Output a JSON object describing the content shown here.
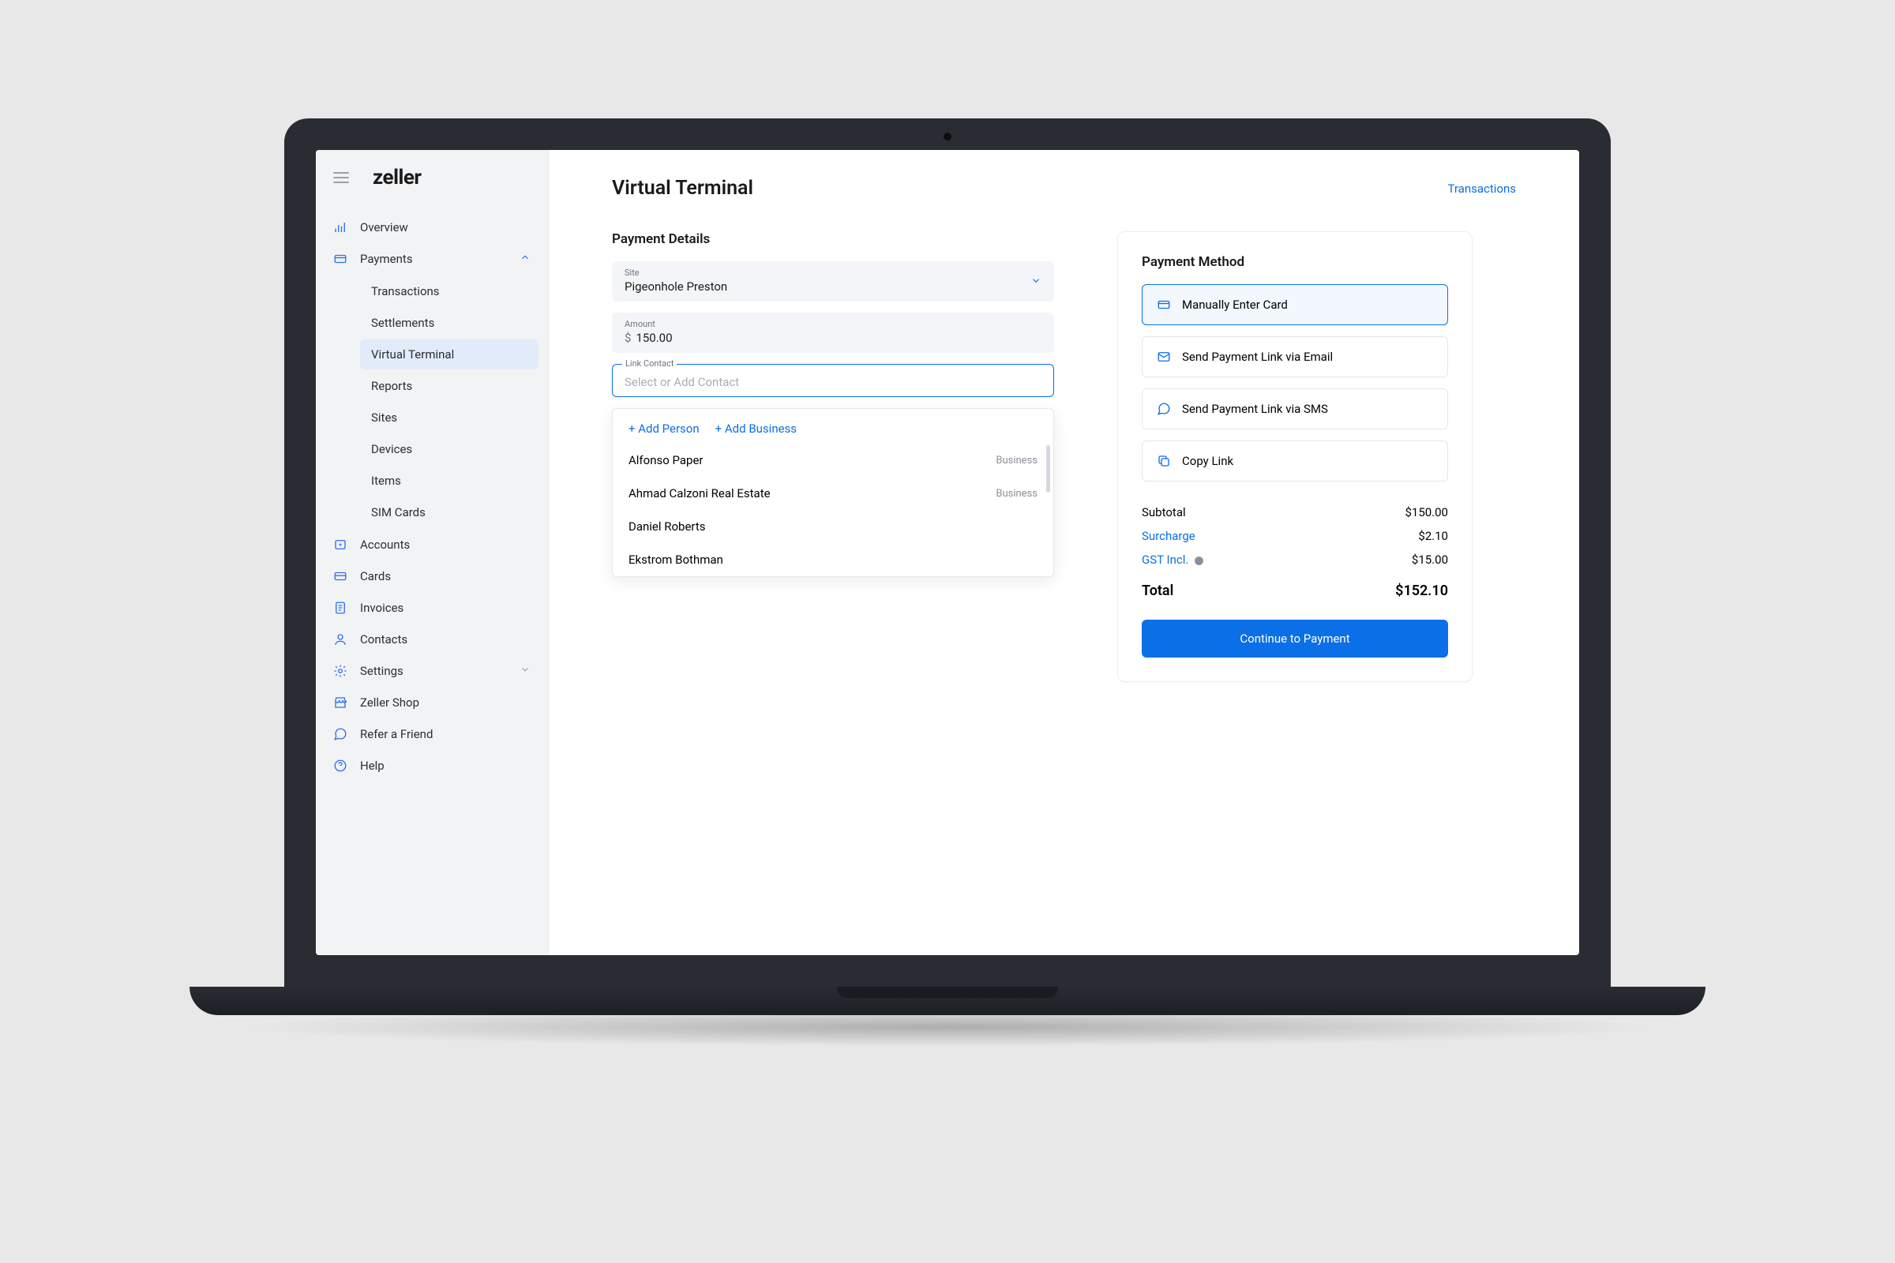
{
  "brand": "zeller",
  "header": {
    "title": "Virtual Terminal",
    "link": "Transactions"
  },
  "sidebar": {
    "items": [
      {
        "label": "Overview"
      },
      {
        "label": "Payments",
        "expanded": true,
        "sub": [
          {
            "label": "Transactions"
          },
          {
            "label": "Settlements"
          },
          {
            "label": "Virtual Terminal",
            "active": true
          },
          {
            "label": "Reports"
          },
          {
            "label": "Sites"
          },
          {
            "label": "Devices"
          },
          {
            "label": "Items"
          },
          {
            "label": "SIM Cards"
          }
        ]
      },
      {
        "label": "Accounts"
      },
      {
        "label": "Cards"
      },
      {
        "label": "Invoices"
      },
      {
        "label": "Contacts"
      },
      {
        "label": "Settings",
        "expandable": true
      },
      {
        "label": "Zeller Shop"
      },
      {
        "label": "Refer a Friend"
      },
      {
        "label": "Help"
      }
    ]
  },
  "details": {
    "title": "Payment Details",
    "site": {
      "label": "Site",
      "value": "Pigeonhole Preston"
    },
    "amount": {
      "label": "Amount",
      "currency": "$",
      "value": "150.00"
    },
    "contact": {
      "label": "Link Contact",
      "placeholder": "Select or Add Contact"
    },
    "dropdown": {
      "addPerson": "+ Add Person",
      "addBusiness": "+ Add Business",
      "items": [
        {
          "name": "Alfonso Paper",
          "tag": "Business"
        },
        {
          "name": "Ahmad Calzoni Real Estate",
          "tag": "Business"
        },
        {
          "name": "Daniel Roberts",
          "tag": ""
        },
        {
          "name": "Ekstrom Bothman",
          "tag": ""
        }
      ]
    }
  },
  "payment": {
    "title": "Payment Method",
    "methods": [
      {
        "label": "Manually Enter Card",
        "selected": true
      },
      {
        "label": "Send Payment Link via Email"
      },
      {
        "label": "Send Payment Link via SMS"
      },
      {
        "label": "Copy Link"
      }
    ],
    "summary": {
      "subtotal": {
        "label": "Subtotal",
        "value": "$150.00"
      },
      "surcharge": {
        "label": "Surcharge",
        "value": "$2.10"
      },
      "gst": {
        "label": "GST Incl.",
        "value": "$15.00"
      },
      "total": {
        "label": "Total",
        "value": "$152.10"
      }
    },
    "cta": "Continue to Payment"
  }
}
